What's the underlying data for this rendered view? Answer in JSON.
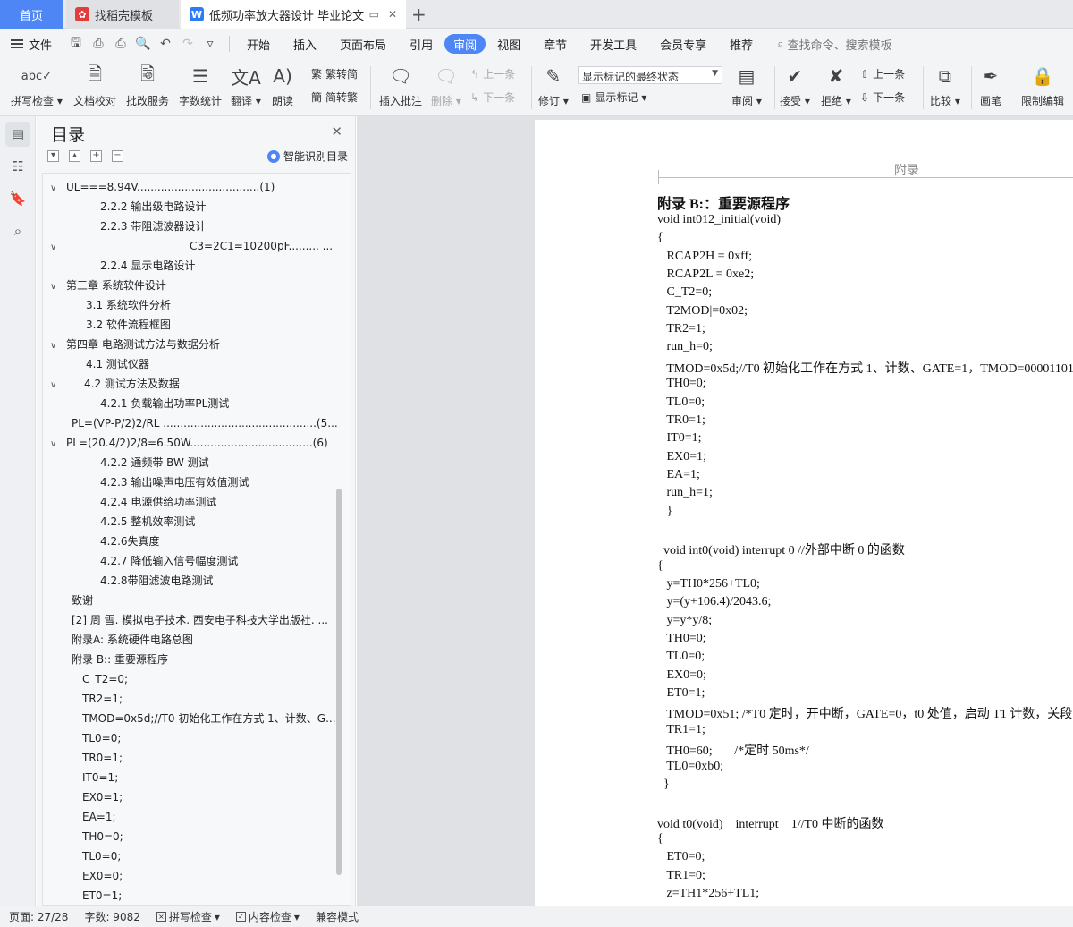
{
  "tabs": {
    "home": "首页",
    "template": "找稻壳模板",
    "document": "低频功率放大器设计 毕业论文"
  },
  "menu": {
    "file": "文件",
    "items": [
      "开始",
      "插入",
      "页面布局",
      "引用",
      "审阅",
      "视图",
      "章节",
      "开发工具",
      "会员专享",
      "推荐"
    ],
    "active": "审阅",
    "search_placeholder": "查找命令、搜索模板"
  },
  "ribbon": {
    "spell_check": "拼写检查",
    "doc_proof": "文档校对",
    "revise_service": "批改服务",
    "word_count": "字数统计",
    "translate": "翻译",
    "read_aloud": "朗读",
    "trad_to_simp": "繁转简",
    "simp_to_trad": "简转繁",
    "insert_comment": "插入批注",
    "delete": "删除",
    "prev_comment": "上一条",
    "next_comment": "下一条",
    "track_changes": "修订",
    "display_mode": "显示标记的最终状态",
    "show_markup": "显示标记",
    "review": "审阅",
    "accept": "接受",
    "reject": "拒绝",
    "prev_change": "上一条",
    "next_change": "下一条",
    "compare": "比较",
    "pen": "画笔",
    "restrict_edit": "限制编辑"
  },
  "toc": {
    "title": "目录",
    "smart_detect": "智能识别目录",
    "items": [
      {
        "text": "UL===8.94V....................................(1)",
        "caret": "v"
      },
      {
        "text": "2.2.2  输出级电路设计",
        "caret": ""
      },
      {
        "text": "2.2.3  带阻滤波器设计",
        "caret": ""
      },
      {
        "text": "C3=2C1=10200pF.........  ...",
        "caret": "v"
      },
      {
        "text": "2.2.4  显示电路设计",
        "caret": ""
      },
      {
        "text": "第三章    系统软件设计",
        "caret": "v"
      },
      {
        "text": "3.1  系统软件分析",
        "caret": ""
      },
      {
        "text": "3.2  软件流程框图",
        "caret": ""
      },
      {
        "text": "第四章    电路测试方法与数据分析",
        "caret": "v"
      },
      {
        "text": "4.1  测试仪器",
        "caret": ""
      },
      {
        "text": "4.2  测试方法及数据",
        "caret": "v"
      },
      {
        "text": "4.2.1  负载输出功率PL测试",
        "caret": ""
      },
      {
        "text": "PL=(VP-P/2)2/RL .............................................(5...",
        "caret": ""
      },
      {
        "text": "PL=(20.4/2)2/8=6.50W....................................(6)",
        "caret": "v"
      },
      {
        "text": "4.2.2  通频带 BW 测试",
        "caret": ""
      },
      {
        "text": "4.2.3  输出噪声电压有效值测试",
        "caret": ""
      },
      {
        "text": "4.2.4  电源供给功率测试",
        "caret": ""
      },
      {
        "text": "4.2.5  整机效率测试",
        "caret": ""
      },
      {
        "text": "4.2.6失真度",
        "caret": ""
      },
      {
        "text": "4.2.7 降低输入信号幅度测试",
        "caret": ""
      },
      {
        "text": "4.2.8带阻滤波电路测试",
        "caret": ""
      },
      {
        "text": "致谢",
        "caret": ""
      },
      {
        "text": "[2]  周  雪. 模拟电子技术. 西安电子科技大学出版社. ...",
        "caret": ""
      },
      {
        "text": "附录A:  系统硬件电路总图",
        "caret": ""
      },
      {
        "text": "附录 B:: 重要源程序",
        "caret": ""
      },
      {
        "text": "C_T2=0;",
        "caret": ""
      },
      {
        "text": "TR2=1;",
        "caret": ""
      },
      {
        "text": "TMOD=0x5d;//T0 初始化工作在方式 1、计数、G...",
        "caret": ""
      },
      {
        "text": "TL0=0;",
        "caret": ""
      },
      {
        "text": "TR0=1;",
        "caret": ""
      },
      {
        "text": "IT0=1;",
        "caret": ""
      },
      {
        "text": "EX0=1;",
        "caret": ""
      },
      {
        "text": "EA=1;",
        "caret": ""
      },
      {
        "text": "TH0=0;",
        "caret": ""
      },
      {
        "text": "TL0=0;",
        "caret": ""
      },
      {
        "text": "EX0=0;",
        "caret": ""
      },
      {
        "text": "ET0=1;",
        "caret": ""
      }
    ]
  },
  "document": {
    "header": "附录",
    "lines": [
      "附录 B:：重要源程序",
      "void int012_initial(void)",
      "{",
      "   RCAP2H = 0xff;",
      "   RCAP2L = 0xe2;",
      "   C_T2=0;",
      "   T2MOD|=0x02;",
      "   TR2=1;",
      "   run_h=0;",
      "   TMOD=0x5d;//T0 初始化工作在方式 1、计数、GATE=1，TMOD=00001101",
      "   TH0=0;",
      "   TL0=0;",
      "   TR0=1;",
      "   IT0=1;",
      "   EX0=1;",
      "   EA=1;",
      "   run_h=1;",
      "   }",
      "",
      "  void int0(void) interrupt 0 //外部中断 0 的函数",
      "{",
      "   y=TH0*256+TL0;",
      "   y=(y+106.4)/2043.6;",
      "   y=y*y/8;",
      "   TH0=0;",
      "   TL0=0;",
      "   EX0=0;",
      "   ET0=1;",
      "   TMOD=0x51; /*T0 定时，开中断，GATE=0，t0 处值，启动 T1 计数，关段",
      "   TR1=1;",
      "   TH0=60;       /*定时 50ms*/",
      "   TL0=0xb0;",
      "  }",
      "",
      "void t0(void)    interrupt    1//T0 中断的函数",
      "{",
      "   ET0=0;",
      "   TR1=0;",
      "   z=TH1*256+TL1;"
    ]
  },
  "status": {
    "page": "页面: 27/28",
    "words": "字数: 9082",
    "spell": "拼写检查",
    "content_check": "内容检查",
    "compat": "兼容模式"
  }
}
